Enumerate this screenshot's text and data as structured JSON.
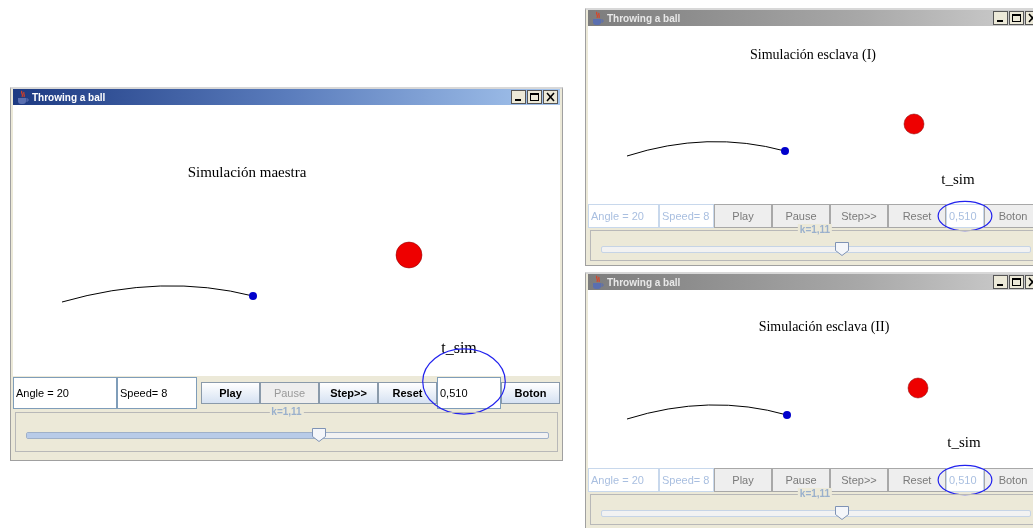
{
  "windows": [
    {
      "title": "Throwing a ball",
      "active": true,
      "heading": "Simulación maestra",
      "time_label": "t_sim",
      "angle": {
        "value": "Angle = 20"
      },
      "speed": {
        "value": "Speed= 8"
      },
      "buttons": [
        {
          "label": "Play",
          "disabled": false
        },
        {
          "label": "Pause",
          "disabled": true
        },
        {
          "label": "Step>>",
          "disabled": false
        },
        {
          "label": "Reset",
          "disabled": false
        }
      ],
      "time": {
        "value": "0,510",
        "highlighted": true
      },
      "extra_button": {
        "label": "Boton",
        "disabled": false
      },
      "slider": {
        "label": "k=1,11",
        "level": 0.56
      }
    },
    {
      "title": "Throwing a ball",
      "active": false,
      "heading": "Simulación esclava (I)",
      "time_label": "t_sim",
      "angle": {
        "value": "Angle = 20"
      },
      "speed": {
        "value": "Speed= 8"
      },
      "buttons": [
        {
          "label": "Play",
          "disabled": false
        },
        {
          "label": "Pause",
          "disabled": false
        },
        {
          "label": "Step>>",
          "disabled": false
        },
        {
          "label": "Reset",
          "disabled": false
        }
      ],
      "time": {
        "value": "0,510",
        "highlighted": true
      },
      "extra_button": {
        "label": "Boton",
        "disabled": false
      },
      "slider": {
        "label": "k=1,11",
        "level": 0.56
      }
    },
    {
      "title": "Throwing a ball",
      "active": false,
      "heading": "Simulación esclava (II)",
      "time_label": "t_sim",
      "angle": {
        "value": "Angle = 20"
      },
      "speed": {
        "value": "Speed= 8"
      },
      "buttons": [
        {
          "label": "Play",
          "disabled": false
        },
        {
          "label": "Pause",
          "disabled": false
        },
        {
          "label": "Step>>",
          "disabled": false
        },
        {
          "label": "Reset",
          "disabled": false
        }
      ],
      "time": {
        "value": "0,510",
        "highlighted": true
      },
      "extra_button": {
        "label": "Boton",
        "disabled": false
      },
      "slider": {
        "label": "k=1,11",
        "level": 0.56
      }
    }
  ]
}
